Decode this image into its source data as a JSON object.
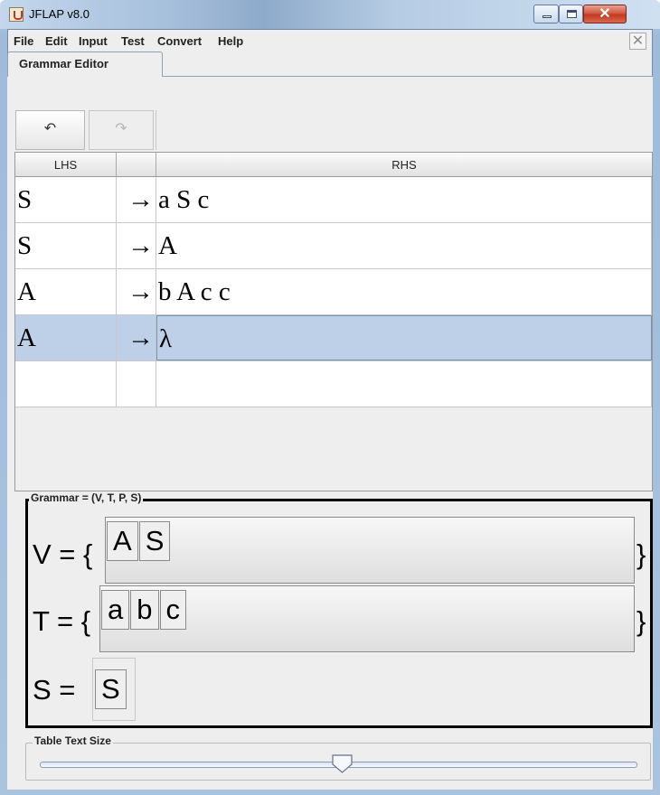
{
  "window": {
    "title": "JFLAP v8.0"
  },
  "menu": [
    "File",
    "Edit",
    "Input",
    "Test",
    "Convert",
    "Help"
  ],
  "menu_close_glyph": "✕",
  "tab": {
    "label": "Grammar Editor"
  },
  "toolbar": {
    "undo_icon": "undo-arrow-icon",
    "redo_icon": "redo-arrow-icon",
    "undo_glyph": "↶",
    "redo_glyph": "↷"
  },
  "table": {
    "headers": {
      "lhs": "LHS",
      "arrow": "",
      "rhs": "RHS"
    },
    "rows": [
      {
        "lhs": "S",
        "arrow": "→",
        "rhs": "a S c"
      },
      {
        "lhs": "S",
        "arrow": "→",
        "rhs": "A"
      },
      {
        "lhs": "A",
        "arrow": "→",
        "rhs": "b A c c"
      },
      {
        "lhs": "A",
        "arrow": "→",
        "rhs": "λ"
      },
      {
        "lhs": "",
        "arrow": "",
        "rhs": ""
      }
    ],
    "selected_row": 3
  },
  "grammar": {
    "title": "Grammar = (V, T, P, S)",
    "v_label": "V = {",
    "t_label": "T = {",
    "s_label": "S =",
    "close_brace": "}",
    "variables": [
      "A",
      "S"
    ],
    "terminals": [
      "a",
      "b",
      "c"
    ],
    "start": "S"
  },
  "slider": {
    "title": "Table Text Size",
    "value_fraction": 0.5
  },
  "colors": {
    "selection": "#bdd0e7",
    "titlebar": "#a7c0dc",
    "close_button": "#c2391e"
  }
}
